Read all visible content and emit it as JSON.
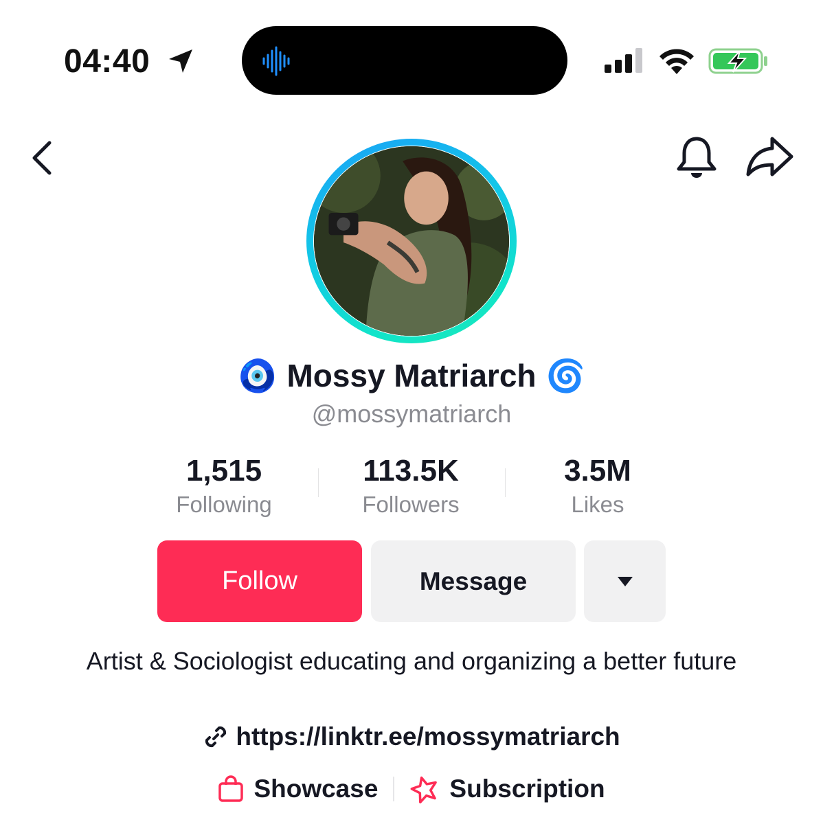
{
  "status_bar": {
    "time": "04:40",
    "icons": [
      "location-arrow-icon",
      "audio-waveform-icon",
      "cellular-signal-icon",
      "wifi-icon",
      "battery-charging-icon"
    ],
    "battery_color": "#34c759"
  },
  "nav": {
    "icons": [
      "back-chevron-icon",
      "bell-icon",
      "share-arrow-icon"
    ]
  },
  "profile": {
    "name_prefix_emoji": "🧿",
    "name": "Mossy Matriarch",
    "name_suffix_emoji": "🌀",
    "handle": "@mossymatriarch",
    "avatar_ring_colors": [
      "#1aa2f6",
      "#11e5c8"
    ]
  },
  "stats": [
    {
      "value": "1,515",
      "label": "Following"
    },
    {
      "value": "113.5K",
      "label": "Followers"
    },
    {
      "value": "3.5M",
      "label": "Likes"
    }
  ],
  "actions": {
    "follow_label": "Follow",
    "message_label": "Message",
    "more_icon": "caret-down-icon",
    "follow_color": "#fe2c55"
  },
  "bio": {
    "text": "Artist & Sociologist educating and organizing a better future",
    "link": "https://linktr.ee/mossymatriarch"
  },
  "extras": {
    "showcase_label": "Showcase",
    "subscription_label": "Subscription",
    "accent_color": "#fe2c55"
  }
}
